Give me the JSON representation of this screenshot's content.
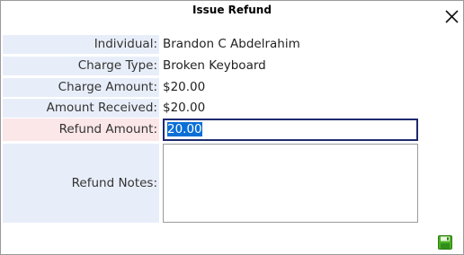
{
  "dialog": {
    "title": "Issue Refund"
  },
  "fields": {
    "individual": {
      "label": "Individual:",
      "value": "Brandon C Abdelrahim"
    },
    "charge_type": {
      "label": "Charge Type:",
      "value": "Broken Keyboard"
    },
    "charge_amount": {
      "label": "Charge Amount:",
      "value": "$20.00"
    },
    "amount_received": {
      "label": "Amount Received:",
      "value": "$20.00"
    },
    "refund_amount": {
      "label": "Refund Amount:",
      "value": "20.00"
    },
    "refund_notes": {
      "label": "Refund Notes:",
      "value": ""
    }
  },
  "icons": {
    "close": "close-icon",
    "save": "save-icon",
    "save_color": "#4caf24"
  },
  "colors": {
    "label_bg": "#e8eef9",
    "required_label_bg": "#fbe6e8",
    "input_border_focus": "#1f2a6e",
    "selection": "#0b6fd6"
  }
}
